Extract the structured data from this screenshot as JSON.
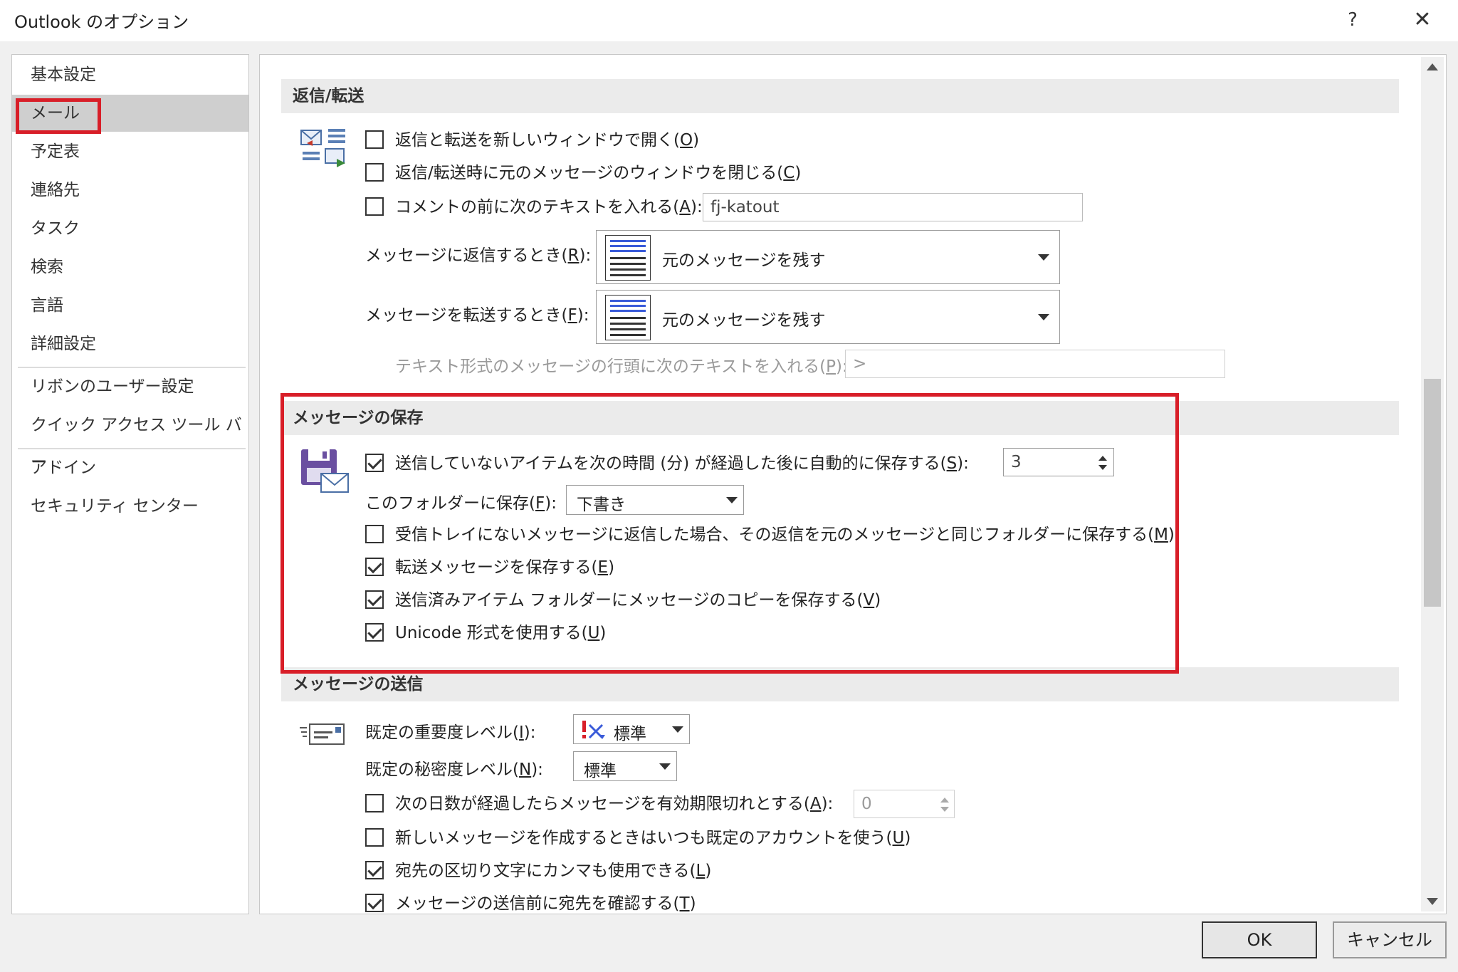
{
  "window": {
    "title": "Outlook のオプション",
    "help": "?",
    "close": "✕"
  },
  "sidebar": {
    "items": [
      {
        "label": "基本設定"
      },
      {
        "label": "メール"
      },
      {
        "label": "予定表"
      },
      {
        "label": "連絡先"
      },
      {
        "label": "タスク"
      },
      {
        "label": "検索"
      },
      {
        "label": "言語"
      },
      {
        "label": "詳細設定"
      },
      {
        "label": "リボンのユーザー設定"
      },
      {
        "label": "クイック アクセス ツール バー"
      },
      {
        "label": "アドイン"
      },
      {
        "label": "セキュリティ センター"
      }
    ],
    "selected": "メール"
  },
  "reply": {
    "header": "返信/転送",
    "open_new_window": {
      "label": "返信と転送を新しいウィンドウで開く(",
      "key": "O",
      "checked": false
    },
    "close_original": {
      "label": "返信/転送時に元のメッセージのウィンドウを閉じる(",
      "key": "C",
      "checked": false
    },
    "comment_prefix": {
      "label": "コメントの前に次のテキストを入れる(",
      "key": "A",
      "suffix": "):",
      "checked": false,
      "value": "fj-katout"
    },
    "when_reply": {
      "label": "メッセージに返信するとき(",
      "key": "R",
      "suffix": "):",
      "value": "元のメッセージを残す"
    },
    "when_forward": {
      "label": "メッセージを転送するとき(",
      "key": "F",
      "suffix": "):",
      "value": "元のメッセージを残す"
    },
    "prefix_text": {
      "label": "テキスト形式のメッセージの行頭に次のテキストを入れる(",
      "key": "P",
      "suffix": "):",
      "value": ">"
    }
  },
  "save": {
    "header": "メッセージの保存",
    "autosave": {
      "label": "送信していないアイテムを次の時間 (分) が経過した後に自動的に保存する(",
      "key": "S",
      "suffix": "):",
      "checked": true,
      "value": "3"
    },
    "folder": {
      "label": "このフォルダーに保存(",
      "key": "F",
      "suffix": "):",
      "value": "下書き"
    },
    "reply_same_folder": {
      "label": "受信トレイにないメッセージに返信した場合、その返信を元のメッセージと同じフォルダーに保存する(",
      "key": "M",
      "checked": false
    },
    "save_forwarded": {
      "label": "転送メッセージを保存する(",
      "key": "E",
      "checked": true
    },
    "save_sent_copy": {
      "label": "送信済みアイテム フォルダーにメッセージのコピーを保存する(",
      "key": "V",
      "checked": true
    },
    "use_unicode": {
      "label": "Unicode 形式を使用する(",
      "key": "U",
      "checked": true
    }
  },
  "send": {
    "header": "メッセージの送信",
    "importance": {
      "label": "既定の重要度レベル(",
      "key": "I",
      "suffix": "):",
      "value": "標準"
    },
    "sensitivity": {
      "label": "既定の秘密度レベル(",
      "key": "N",
      "suffix": "):",
      "value": "標準"
    },
    "expire": {
      "label": "次の日数が経過したらメッセージを有効期限切れとする(",
      "key": "A",
      "suffix": "):",
      "checked": false,
      "value": "0"
    },
    "default_account": {
      "label": "新しいメッセージを作成するときはいつも既定のアカウントを使う(",
      "key": "U",
      "checked": false
    },
    "comma_separator": {
      "label": "宛先の区切り文字にカンマも使用できる(",
      "key": "L",
      "checked": true
    },
    "check_names": {
      "label": "メッセージの送信前に宛先を確認する(",
      "key": "T",
      "checked": true
    }
  },
  "buttons": {
    "ok": "OK",
    "cancel": "キャンセル"
  },
  "colors": {
    "highlight": "#d81e28",
    "selected_nav": "#cfcfcf",
    "section_header": "#ebebeb"
  }
}
